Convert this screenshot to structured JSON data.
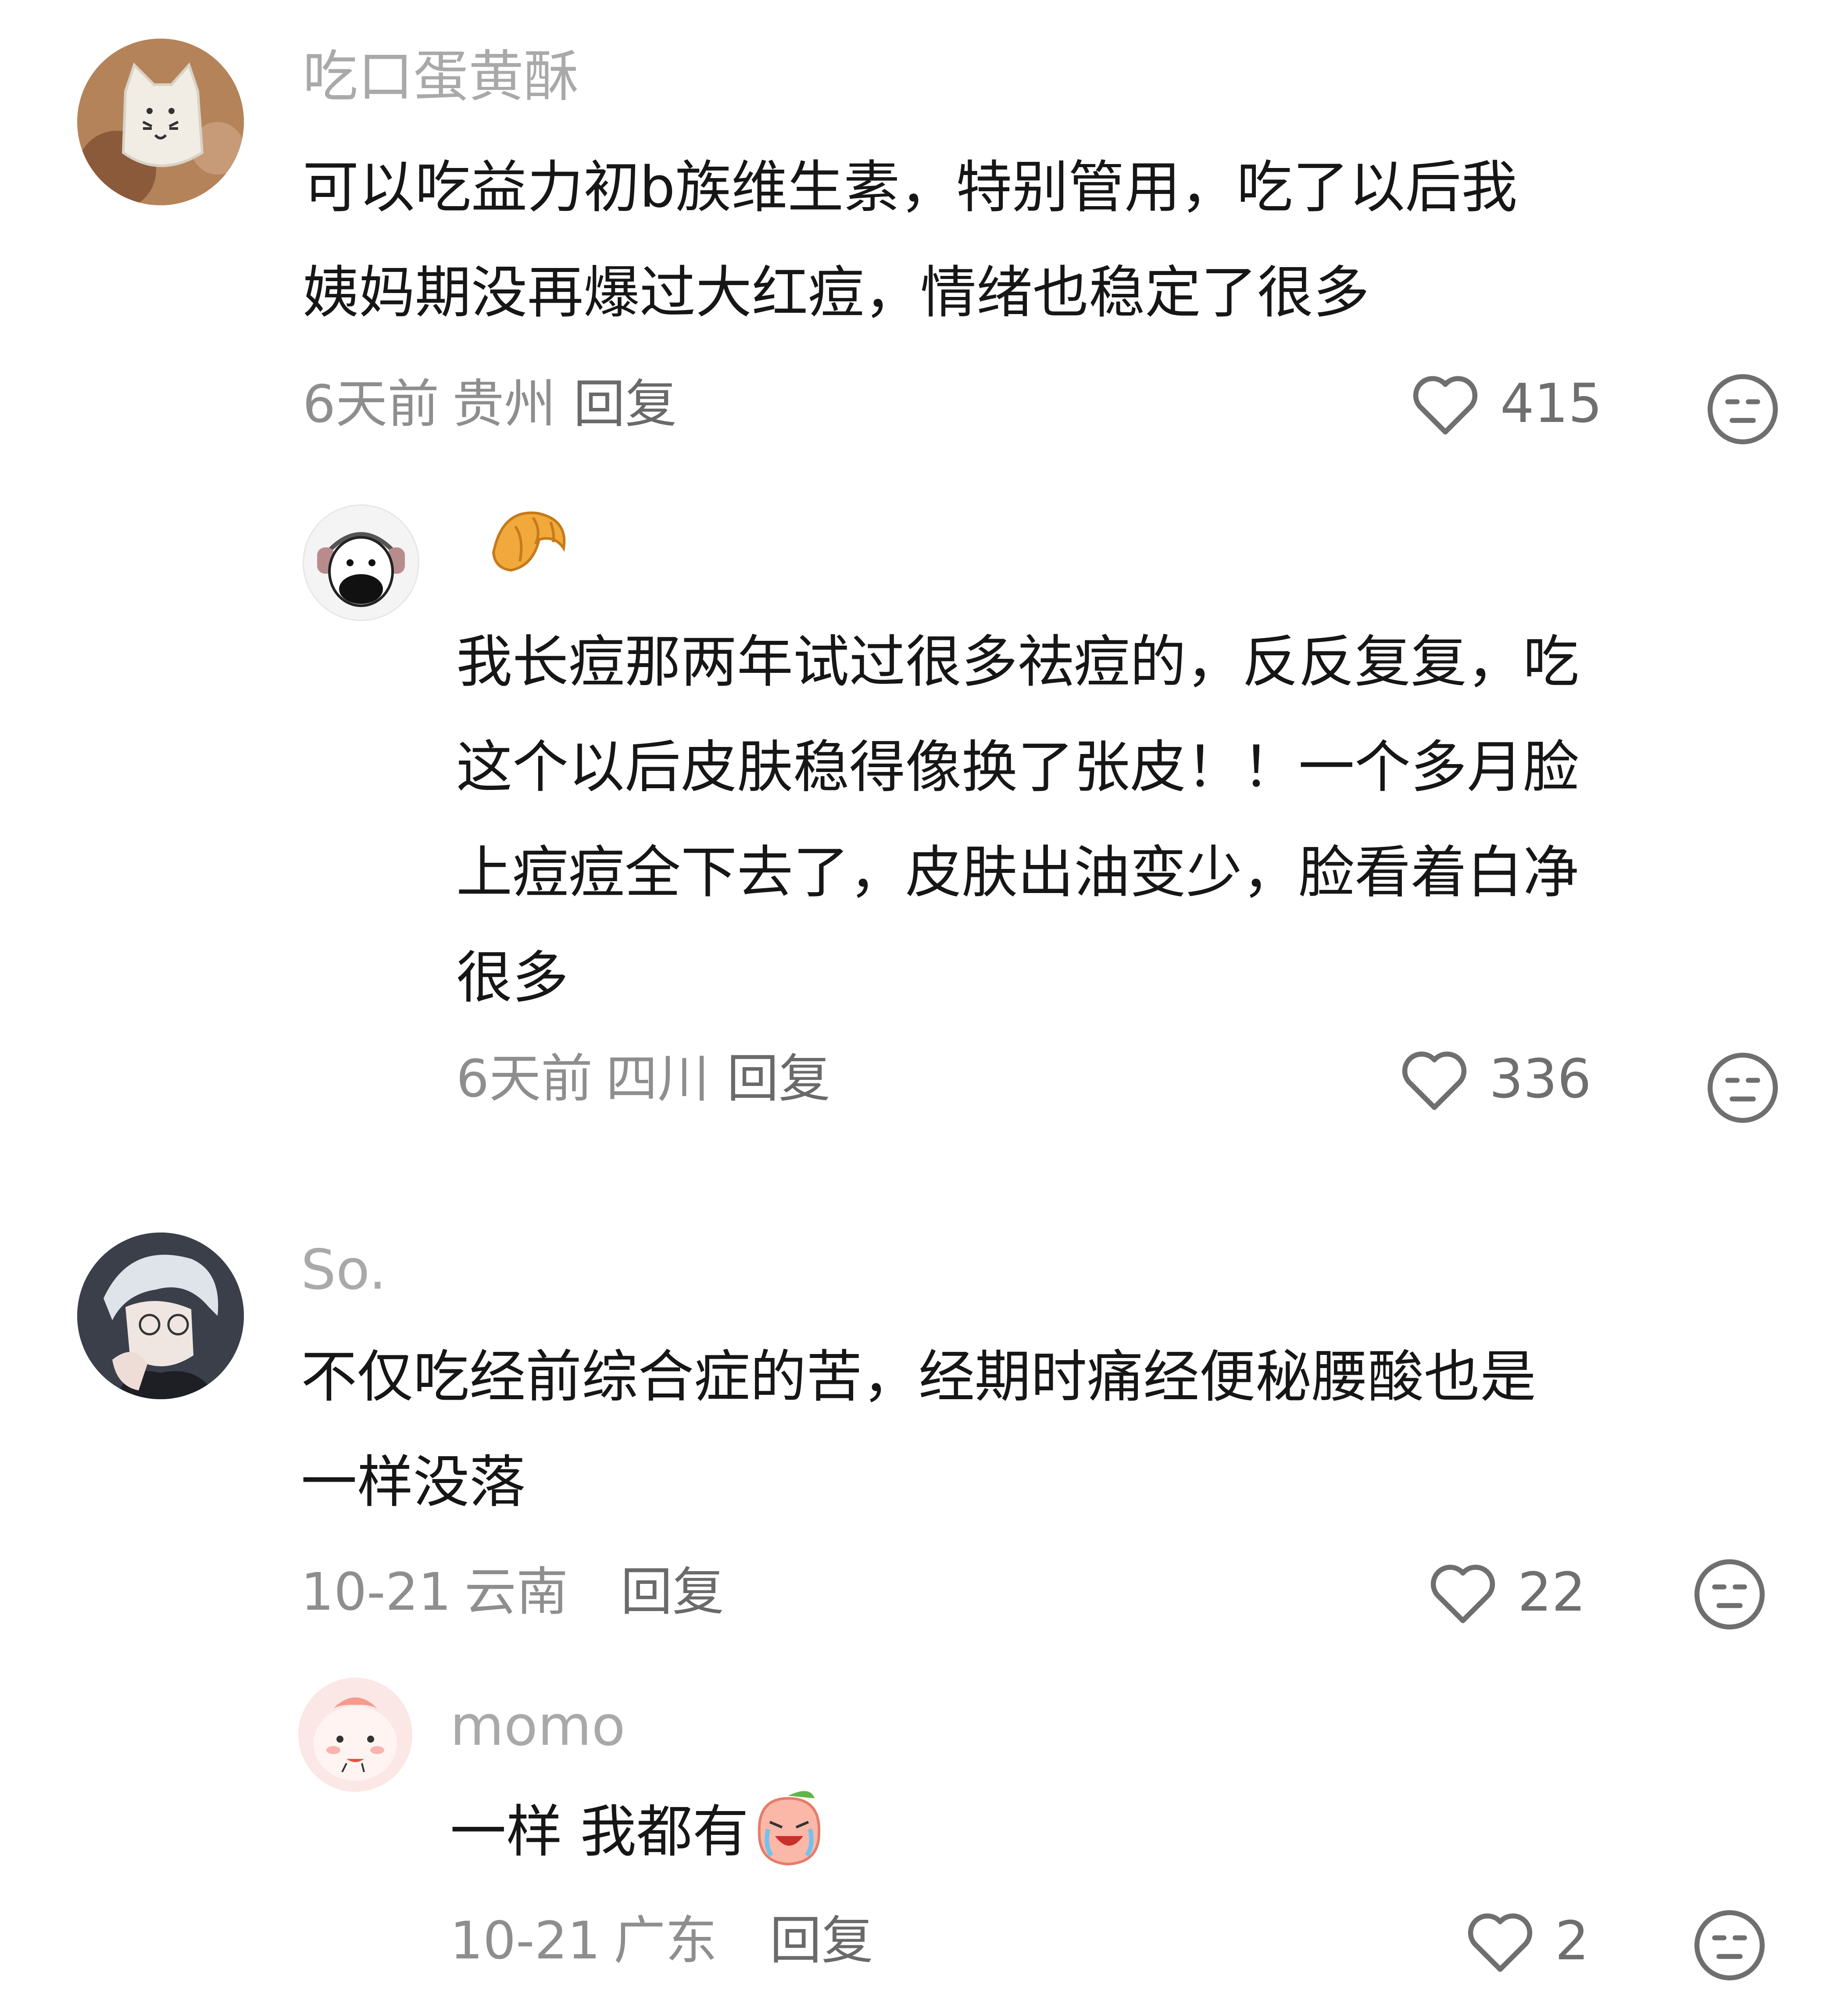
{
  "comments": [
    {
      "user": "吃口蛋黄酥",
      "lines": [
        "可以吃益力初b族维生素，特别管用，吃了以后我",
        "姨妈期没再爆过大红痘，情绪也稳定了很多"
      ],
      "time": "6天前",
      "location": "贵州",
      "reply_label": "回复",
      "likes": "415",
      "avatar_icon": "cat-mask-avatar-icon",
      "replies": [
        {
          "user_emoji": "croissant-emoji",
          "lines": [
            "我长痘那两年试过很多祛痘的，反反复复，吃",
            "这个以后皮肤稳得像换了张皮！！一个多月脸",
            "上痘痘全下去了，皮肤出油变少，脸看着白净",
            "很多"
          ],
          "time": "6天前",
          "location": "四川",
          "reply_label": "回复",
          "likes": "336",
          "avatar_icon": "cow-headphones-avatar-icon"
        }
      ]
    },
    {
      "user": "So.",
      "lines": [
        "不仅吃经前综合症的苦，经期时痛经便秘腰酸也是",
        "一样没落"
      ],
      "time": "10-21",
      "location": "云南",
      "reply_label": "回复",
      "likes": "22",
      "avatar_icon": "anime-boy-avatar-icon",
      "replies": [
        {
          "user": "momo",
          "lines": [
            "一样 我都有"
          ],
          "time": "10-21",
          "location": "广东",
          "reply_label": "回复",
          "likes": "2",
          "avatar_icon": "pink-cartoon-avatar-icon",
          "trailing_emoji": "crying-peach-emoji"
        }
      ]
    }
  ],
  "icons": {
    "like": "heart-outline-icon",
    "dislike": "neutral-face-icon"
  },
  "colors": {
    "background": "#ffffff",
    "username": "#a9a9a9",
    "body_text": "#161616",
    "meta_text": "#8e8e8e"
  }
}
